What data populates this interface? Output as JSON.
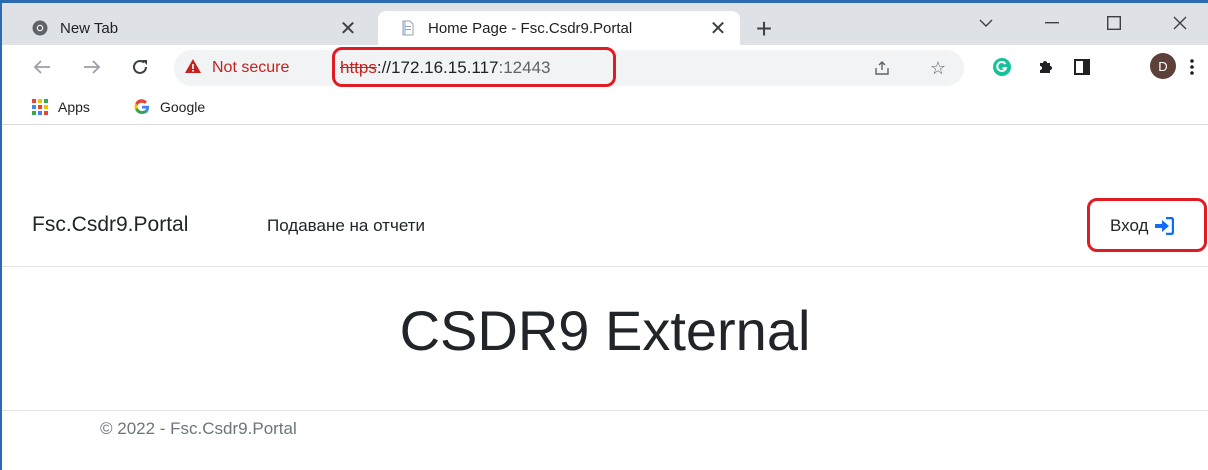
{
  "browser": {
    "tabs": [
      {
        "label": "New Tab",
        "favicon": "chrome-icon",
        "active": false
      },
      {
        "label": "Home Page - Fsc.Csdr9.Portal",
        "favicon": "page-icon",
        "active": true
      }
    ],
    "security_label": "Not secure",
    "url": {
      "scheme": "https",
      "rest": "://172.16.15.117",
      "port": ":12443"
    },
    "profile_initial": "D",
    "colors": {
      "tabstrip": "#dee1e6",
      "warning": "#c5221f",
      "highlight": "#e01b24",
      "avatar": "#5d4037"
    }
  },
  "bookmarks": [
    {
      "label": "Apps",
      "icon": "apps-grid-icon"
    },
    {
      "label": "Google",
      "icon": "google-icon"
    }
  ],
  "page": {
    "brand": "Fsc.Csdr9.Portal",
    "nav_link": "Подаване на отчети",
    "login_label": "Вход",
    "heading": "CSDR9 External",
    "footer": "© 2022 - Fsc.Csdr9.Portal",
    "colors": {
      "login_icon": "#0d6efd",
      "text": "#212529",
      "muted": "#6c757d"
    }
  }
}
